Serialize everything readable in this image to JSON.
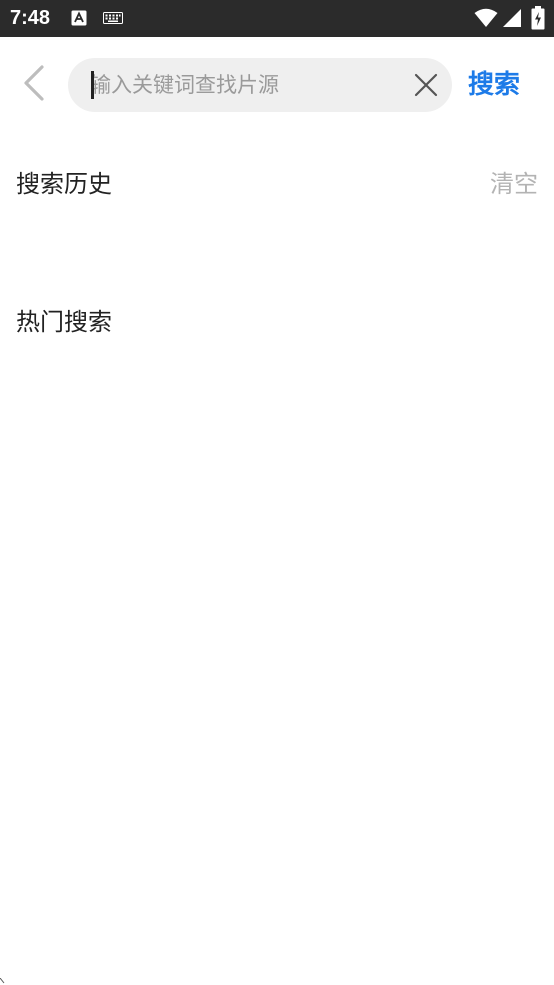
{
  "status_bar": {
    "time": "7:48",
    "icons": [
      "font-a-icon",
      "keyboard-icon",
      "wifi-icon",
      "signal-icon",
      "battery-charging-icon"
    ]
  },
  "search": {
    "placeholder": "输入关键词查找片源",
    "value": "",
    "action_label": "搜索",
    "back_icon": "chevron-left-icon",
    "clear_icon": "close-icon",
    "accent_color": "#1d7be8"
  },
  "history": {
    "title": "搜索历史",
    "clear_label": "清空",
    "items": []
  },
  "hot": {
    "title": "热门搜索",
    "items": []
  }
}
